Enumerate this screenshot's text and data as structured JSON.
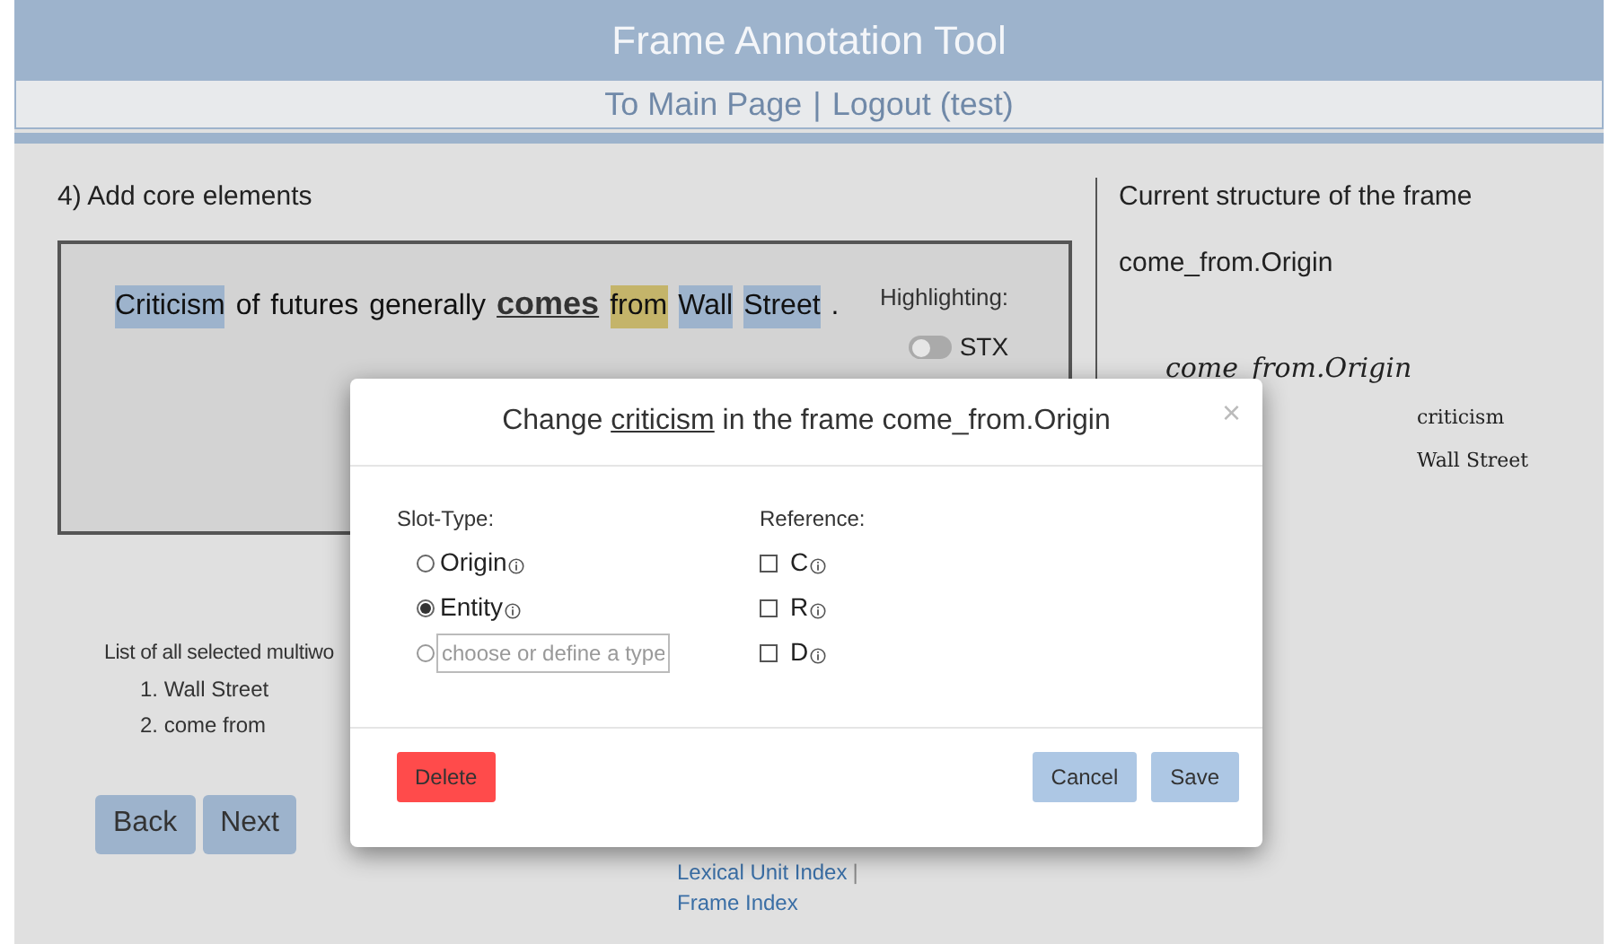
{
  "header": {
    "title": "Frame Annotation Tool"
  },
  "nav": [
    {
      "label": "To Main Page",
      "separator": "|"
    },
    {
      "label": "Logout (test)"
    }
  ],
  "step": {
    "heading": "4) Add core elements",
    "sentence": [
      {
        "text": "Criticism",
        "color": "#9db3cc",
        "target": false
      },
      {
        "text": "of",
        "target": false
      },
      {
        "text": "futures",
        "target": false
      },
      {
        "text": "generally",
        "target": false
      },
      {
        "text": "comes",
        "target": true
      },
      {
        "text": "from",
        "color": "#c4b46a",
        "target": false
      },
      {
        "text": "Wall",
        "color": "#9db3cc",
        "target": false
      },
      {
        "text": "Street",
        "color": "#9db3cc",
        "target": false
      },
      {
        "text": ".",
        "target": false
      }
    ],
    "highlighting": {
      "label": "Highlighting:",
      "toggle_label": "STX",
      "on": false
    },
    "multiword_title": "List of all selected multiwo",
    "multiwords": [
      "1. Wall Street",
      "2. come from"
    ],
    "buttons": [
      "Back",
      "Next"
    ]
  },
  "structure": {
    "heading": "Current structure of the frame",
    "frame": "come_from.Origin",
    "tree": [
      {
        "label": "come_from.Origin",
        "children": [
          {
            "label": "criticism"
          },
          {
            "label": "Wall Street"
          }
        ]
      }
    ]
  },
  "dialog": {
    "title": [
      {
        "text": "Change ",
        "underlined": false
      },
      {
        "text": "criticism",
        "underlined": true
      },
      {
        "text": " in the frame come_from.Origin",
        "underlined": false
      }
    ],
    "close": "×",
    "slot_type_label": "Slot-Type:",
    "slot_types": [
      {
        "kind": "option",
        "label": "Origin",
        "selected": false
      },
      {
        "kind": "option",
        "label": "Entity",
        "selected": true
      },
      {
        "kind": "custom",
        "placeholder": "choose or define a type",
        "selected": false
      }
    ],
    "reference_label": "Reference:",
    "references": [
      {
        "label": "C",
        "checked": false
      },
      {
        "label": "R",
        "checked": false
      },
      {
        "label": "D",
        "checked": false
      }
    ],
    "delete": "Delete",
    "cancel": "Cancel",
    "save": "Save"
  },
  "footer": [
    {
      "label": "Lexical Unit Index",
      "separator": "|"
    },
    {
      "label": "Frame Index"
    }
  ]
}
